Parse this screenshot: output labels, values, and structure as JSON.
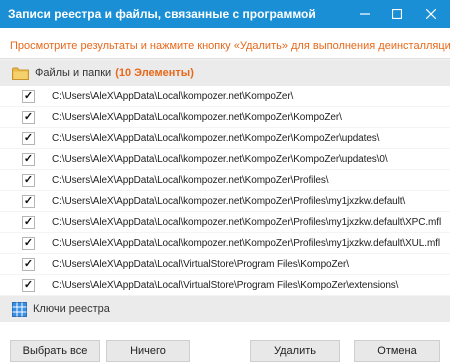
{
  "window": {
    "title": "Записи реестра и файлы, связанные с программой",
    "minimize_glyph": "—",
    "maximize_glyph": "☐",
    "close_glyph": "✕"
  },
  "notice": "Просмотрите результаты и нажмите кнопку «Удалить» для выполнения деинсталляции.",
  "files_section": {
    "label": "Файлы и папки",
    "count": "(10 Элементы)",
    "icon": "folder-icon"
  },
  "items": [
    {
      "checked": true,
      "path": "C:\\Users\\AleX\\AppData\\Local\\kompozer.net\\KompoZer\\"
    },
    {
      "checked": true,
      "path": "C:\\Users\\AleX\\AppData\\Local\\kompozer.net\\KompoZer\\KompoZer\\"
    },
    {
      "checked": true,
      "path": "C:\\Users\\AleX\\AppData\\Local\\kompozer.net\\KompoZer\\KompoZer\\updates\\"
    },
    {
      "checked": true,
      "path": "C:\\Users\\AleX\\AppData\\Local\\kompozer.net\\KompoZer\\KompoZer\\updates\\0\\"
    },
    {
      "checked": true,
      "path": "C:\\Users\\AleX\\AppData\\Local\\kompozer.net\\KompoZer\\Profiles\\"
    },
    {
      "checked": true,
      "path": "C:\\Users\\AleX\\AppData\\Local\\kompozer.net\\KompoZer\\Profiles\\my1jxzkw.default\\"
    },
    {
      "checked": true,
      "path": "C:\\Users\\AleX\\AppData\\Local\\kompozer.net\\KompoZer\\Profiles\\my1jxzkw.default\\XPC.mfl"
    },
    {
      "checked": true,
      "path": "C:\\Users\\AleX\\AppData\\Local\\kompozer.net\\KompoZer\\Profiles\\my1jxzkw.default\\XUL.mfl"
    },
    {
      "checked": true,
      "path": "C:\\Users\\AleX\\AppData\\Local\\VirtualStore\\Program Files\\KompoZer\\"
    },
    {
      "checked": true,
      "path": "C:\\Users\\AleX\\AppData\\Local\\VirtualStore\\Program Files\\KompoZer\\extensions\\"
    }
  ],
  "registry_section": {
    "label": "Ключи реестра",
    "icon": "registry-grid-icon"
  },
  "buttons": {
    "select_all": "Выбрать все",
    "none": "Ничего",
    "delete": "Удалить",
    "cancel": "Отмена"
  },
  "colors": {
    "titlebar": "#1a8fd6",
    "accent_orange": "#e8681a",
    "folder": "#e9b949",
    "registry_icon": "#3a8ee6"
  }
}
